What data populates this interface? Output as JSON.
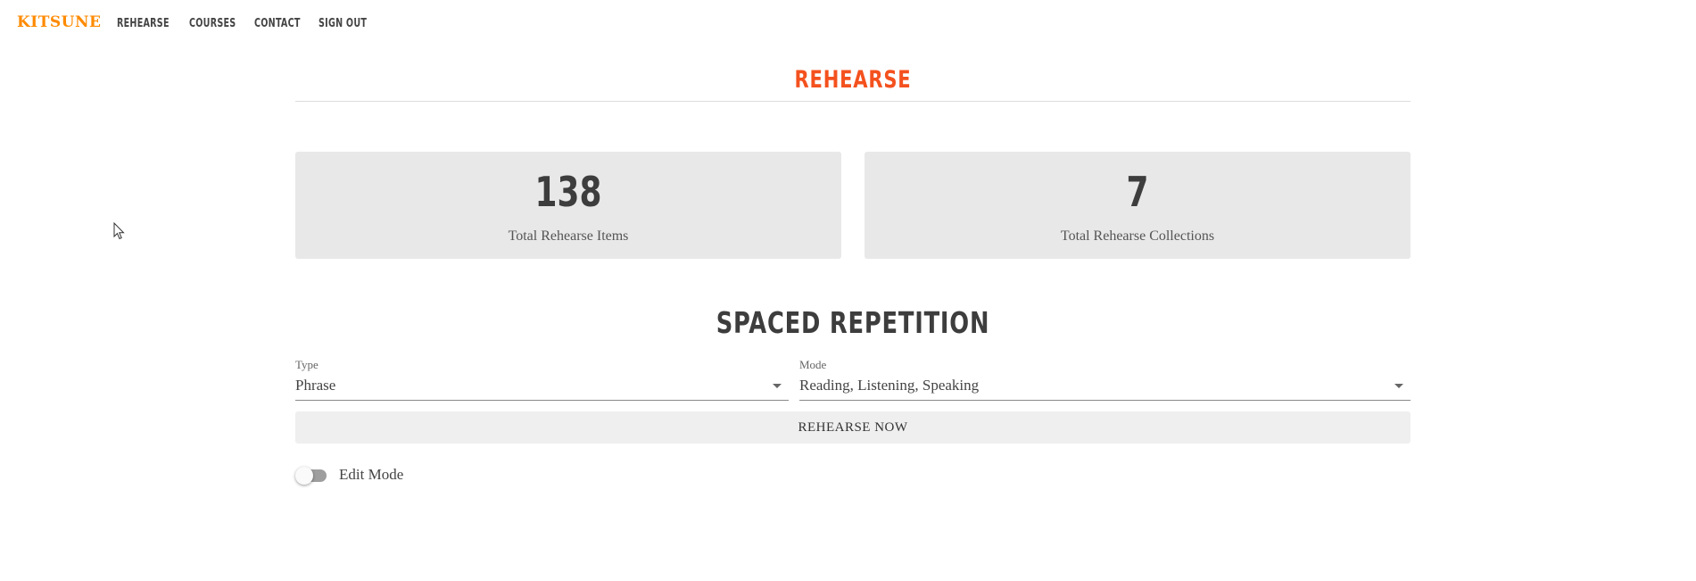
{
  "navbar": {
    "brand": "KITSUNE",
    "links": [
      "REHEARSE",
      "COURSES",
      "CONTACT",
      "SIGN OUT"
    ],
    "brand_color": "#ff8a00"
  },
  "page": {
    "title": "REHEARSE",
    "title_color": "#f4511e"
  },
  "stats": [
    {
      "value": "138",
      "label": "Total Rehearse Items"
    },
    {
      "value": "7",
      "label": "Total Rehearse Collections"
    }
  ],
  "spaced_repetition": {
    "title": "SPACED REPETITION",
    "type": {
      "label": "Type",
      "value": "Phrase"
    },
    "mode": {
      "label": "Mode",
      "value": "Reading, Listening, Speaking"
    },
    "button_label": "REHEARSE NOW"
  },
  "edit_mode": {
    "label": "Edit Mode",
    "enabled": false
  },
  "icons": {
    "dropdown": "chevron-down-icon",
    "pointer": "mouse-cursor-icon"
  }
}
